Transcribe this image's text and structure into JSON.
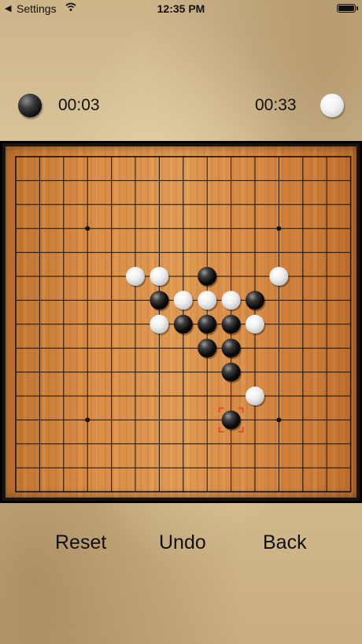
{
  "status_bar": {
    "back_label": "Settings",
    "time": "12:35 PM"
  },
  "players": {
    "black": {
      "timer": "00:03",
      "icon": "black-stone-icon"
    },
    "white": {
      "timer": "00:33",
      "icon": "white-stone-icon"
    }
  },
  "board": {
    "size": 15,
    "star_points": [
      [
        3,
        3
      ],
      [
        11,
        3
      ],
      [
        3,
        11
      ],
      [
        11,
        11
      ]
    ],
    "stones": [
      {
        "color": "white",
        "col": 5,
        "row": 5
      },
      {
        "color": "white",
        "col": 6,
        "row": 5
      },
      {
        "color": "black",
        "col": 8,
        "row": 5
      },
      {
        "color": "white",
        "col": 11,
        "row": 5
      },
      {
        "color": "black",
        "col": 6,
        "row": 6
      },
      {
        "color": "white",
        "col": 7,
        "row": 6
      },
      {
        "color": "white",
        "col": 8,
        "row": 6
      },
      {
        "color": "white",
        "col": 9,
        "row": 6
      },
      {
        "color": "black",
        "col": 10,
        "row": 6
      },
      {
        "color": "white",
        "col": 6,
        "row": 7
      },
      {
        "color": "black",
        "col": 7,
        "row": 7
      },
      {
        "color": "black",
        "col": 8,
        "row": 7
      },
      {
        "color": "black",
        "col": 9,
        "row": 7
      },
      {
        "color": "white",
        "col": 10,
        "row": 7
      },
      {
        "color": "black",
        "col": 8,
        "row": 8
      },
      {
        "color": "black",
        "col": 9,
        "row": 8
      },
      {
        "color": "black",
        "col": 9,
        "row": 9
      },
      {
        "color": "white",
        "col": 10,
        "row": 10
      },
      {
        "color": "black",
        "col": 9,
        "row": 11
      }
    ],
    "last_move": {
      "col": 9,
      "row": 11
    },
    "marker_color": "#e0402a"
  },
  "buttons": {
    "reset": "Reset",
    "undo": "Undo",
    "back": "Back"
  }
}
